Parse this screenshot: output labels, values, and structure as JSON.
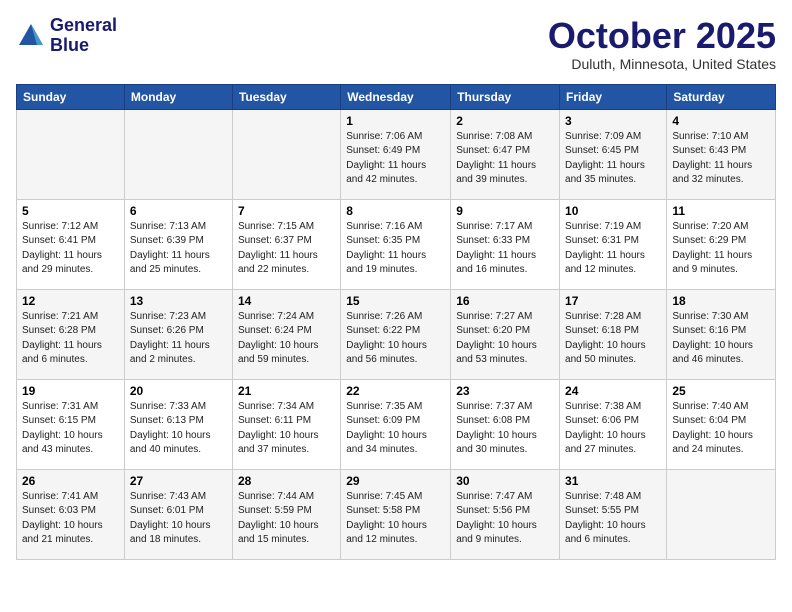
{
  "logo": {
    "line1": "General",
    "line2": "Blue"
  },
  "title": "October 2025",
  "location": "Duluth, Minnesota, United States",
  "days_of_week": [
    "Sunday",
    "Monday",
    "Tuesday",
    "Wednesday",
    "Thursday",
    "Friday",
    "Saturday"
  ],
  "weeks": [
    [
      {
        "num": "",
        "info": ""
      },
      {
        "num": "",
        "info": ""
      },
      {
        "num": "",
        "info": ""
      },
      {
        "num": "1",
        "info": "Sunrise: 7:06 AM\nSunset: 6:49 PM\nDaylight: 11 hours\nand 42 minutes."
      },
      {
        "num": "2",
        "info": "Sunrise: 7:08 AM\nSunset: 6:47 PM\nDaylight: 11 hours\nand 39 minutes."
      },
      {
        "num": "3",
        "info": "Sunrise: 7:09 AM\nSunset: 6:45 PM\nDaylight: 11 hours\nand 35 minutes."
      },
      {
        "num": "4",
        "info": "Sunrise: 7:10 AM\nSunset: 6:43 PM\nDaylight: 11 hours\nand 32 minutes."
      }
    ],
    [
      {
        "num": "5",
        "info": "Sunrise: 7:12 AM\nSunset: 6:41 PM\nDaylight: 11 hours\nand 29 minutes."
      },
      {
        "num": "6",
        "info": "Sunrise: 7:13 AM\nSunset: 6:39 PM\nDaylight: 11 hours\nand 25 minutes."
      },
      {
        "num": "7",
        "info": "Sunrise: 7:15 AM\nSunset: 6:37 PM\nDaylight: 11 hours\nand 22 minutes."
      },
      {
        "num": "8",
        "info": "Sunrise: 7:16 AM\nSunset: 6:35 PM\nDaylight: 11 hours\nand 19 minutes."
      },
      {
        "num": "9",
        "info": "Sunrise: 7:17 AM\nSunset: 6:33 PM\nDaylight: 11 hours\nand 16 minutes."
      },
      {
        "num": "10",
        "info": "Sunrise: 7:19 AM\nSunset: 6:31 PM\nDaylight: 11 hours\nand 12 minutes."
      },
      {
        "num": "11",
        "info": "Sunrise: 7:20 AM\nSunset: 6:29 PM\nDaylight: 11 hours\nand 9 minutes."
      }
    ],
    [
      {
        "num": "12",
        "info": "Sunrise: 7:21 AM\nSunset: 6:28 PM\nDaylight: 11 hours\nand 6 minutes."
      },
      {
        "num": "13",
        "info": "Sunrise: 7:23 AM\nSunset: 6:26 PM\nDaylight: 11 hours\nand 2 minutes."
      },
      {
        "num": "14",
        "info": "Sunrise: 7:24 AM\nSunset: 6:24 PM\nDaylight: 10 hours\nand 59 minutes."
      },
      {
        "num": "15",
        "info": "Sunrise: 7:26 AM\nSunset: 6:22 PM\nDaylight: 10 hours\nand 56 minutes."
      },
      {
        "num": "16",
        "info": "Sunrise: 7:27 AM\nSunset: 6:20 PM\nDaylight: 10 hours\nand 53 minutes."
      },
      {
        "num": "17",
        "info": "Sunrise: 7:28 AM\nSunset: 6:18 PM\nDaylight: 10 hours\nand 50 minutes."
      },
      {
        "num": "18",
        "info": "Sunrise: 7:30 AM\nSunset: 6:16 PM\nDaylight: 10 hours\nand 46 minutes."
      }
    ],
    [
      {
        "num": "19",
        "info": "Sunrise: 7:31 AM\nSunset: 6:15 PM\nDaylight: 10 hours\nand 43 minutes."
      },
      {
        "num": "20",
        "info": "Sunrise: 7:33 AM\nSunset: 6:13 PM\nDaylight: 10 hours\nand 40 minutes."
      },
      {
        "num": "21",
        "info": "Sunrise: 7:34 AM\nSunset: 6:11 PM\nDaylight: 10 hours\nand 37 minutes."
      },
      {
        "num": "22",
        "info": "Sunrise: 7:35 AM\nSunset: 6:09 PM\nDaylight: 10 hours\nand 34 minutes."
      },
      {
        "num": "23",
        "info": "Sunrise: 7:37 AM\nSunset: 6:08 PM\nDaylight: 10 hours\nand 30 minutes."
      },
      {
        "num": "24",
        "info": "Sunrise: 7:38 AM\nSunset: 6:06 PM\nDaylight: 10 hours\nand 27 minutes."
      },
      {
        "num": "25",
        "info": "Sunrise: 7:40 AM\nSunset: 6:04 PM\nDaylight: 10 hours\nand 24 minutes."
      }
    ],
    [
      {
        "num": "26",
        "info": "Sunrise: 7:41 AM\nSunset: 6:03 PM\nDaylight: 10 hours\nand 21 minutes."
      },
      {
        "num": "27",
        "info": "Sunrise: 7:43 AM\nSunset: 6:01 PM\nDaylight: 10 hours\nand 18 minutes."
      },
      {
        "num": "28",
        "info": "Sunrise: 7:44 AM\nSunset: 5:59 PM\nDaylight: 10 hours\nand 15 minutes."
      },
      {
        "num": "29",
        "info": "Sunrise: 7:45 AM\nSunset: 5:58 PM\nDaylight: 10 hours\nand 12 minutes."
      },
      {
        "num": "30",
        "info": "Sunrise: 7:47 AM\nSunset: 5:56 PM\nDaylight: 10 hours\nand 9 minutes."
      },
      {
        "num": "31",
        "info": "Sunrise: 7:48 AM\nSunset: 5:55 PM\nDaylight: 10 hours\nand 6 minutes."
      },
      {
        "num": "",
        "info": ""
      }
    ]
  ]
}
